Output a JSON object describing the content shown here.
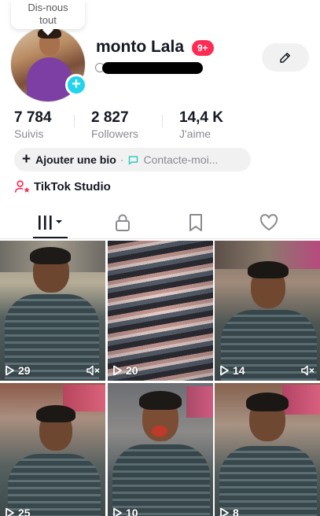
{
  "tooltip": {
    "line1": "Dis-nous",
    "line2": "tout"
  },
  "profile": {
    "username": "monto Lala",
    "notification_badge": "9+"
  },
  "stats": [
    {
      "value": "7 784",
      "label": "Suivis"
    },
    {
      "value": "2 827",
      "label": "Followers"
    },
    {
      "value": "14,4 K",
      "label": "J'aime"
    }
  ],
  "bio": {
    "add_label": "Ajouter une bio",
    "separator": "·",
    "contact_label": "Contacte-moi..."
  },
  "studio": {
    "label": "TikTok Studio"
  },
  "tabs": {
    "icons": [
      "videos-grid-icon",
      "lock-icon",
      "bookmark-icon",
      "heart-icon"
    ],
    "active": "videos-grid-icon"
  },
  "videos": [
    {
      "views": "29",
      "muted": true
    },
    {
      "views": "20",
      "muted": false
    },
    {
      "views": "14",
      "muted": true
    },
    {
      "views": "25",
      "muted": false
    },
    {
      "views": "10",
      "muted": false
    },
    {
      "views": "8",
      "muted": false
    }
  ],
  "colors": {
    "accent_red": "#fe2c55",
    "accent_cyan": "#20d5ec",
    "text_primary": "#161823",
    "text_secondary": "#8a8b91"
  }
}
